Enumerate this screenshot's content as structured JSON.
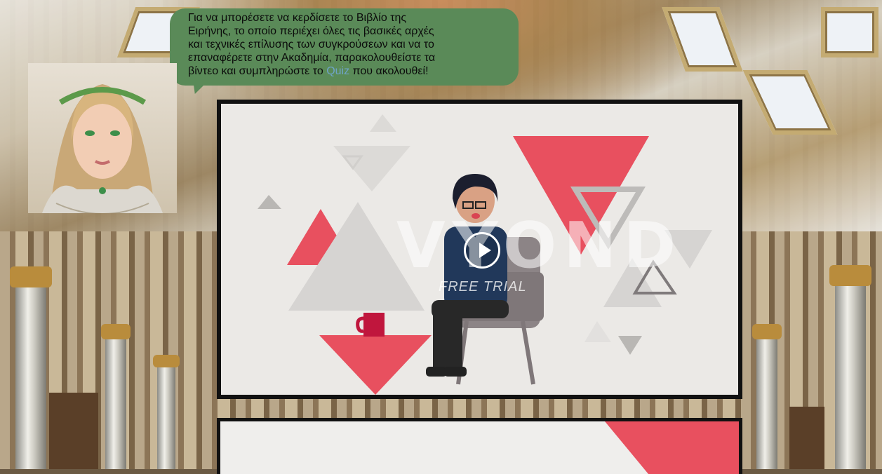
{
  "speech": {
    "line1": "Για να μπορέσετε να κερδίσετε το Βιβλίο της",
    "line2": "Ειρήνης, το οποίο περιέχει όλες τις βασικές αρχές",
    "line3": "και τεχνικές επίλυσης των συγκρούσεων και να το",
    "line4": "επαναφέρετε στην Ακαδημία, παρακολουθείστε τα",
    "line5_a": "βίντεο και συμπληρώστε το ",
    "line5_quiz": "Quiz",
    "line5_b": " που ακολουθεί!"
  },
  "video": {
    "watermark": "VYOND",
    "watermark_sub": "FREE TRIAL",
    "play_icon": "play-icon"
  },
  "colors": {
    "bubble": "#5a8a58",
    "accent_red": "#e8505f",
    "shape_grey": "#d6d4d2"
  }
}
